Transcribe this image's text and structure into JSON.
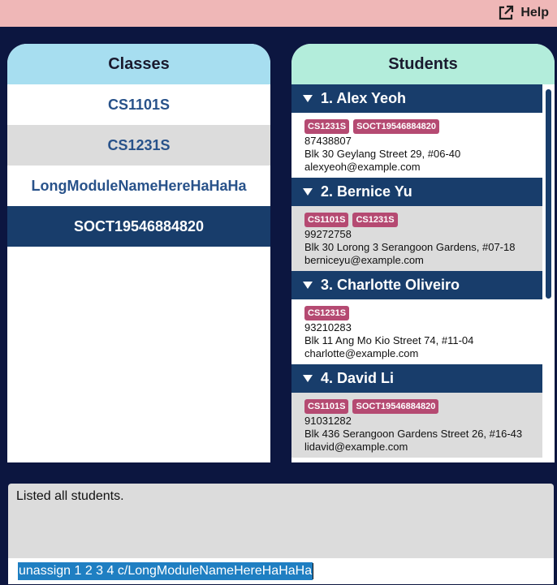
{
  "topbar": {
    "help_label": "Help"
  },
  "classes": {
    "header": "Classes",
    "items": [
      "CS1101S",
      "CS1231S",
      "LongModuleNameHereHaHaHa",
      "SOCT19546884820"
    ],
    "selected_index": 3
  },
  "students": {
    "header": "Students",
    "cards": [
      {
        "title": "1. Alex Yeoh",
        "tags": [
          "CS1231S",
          "SOCT19546884820"
        ],
        "phone": "87438807",
        "address": "Blk 30 Geylang Street 29, #06-40",
        "email": "alexyeoh@example.com"
      },
      {
        "title": "2. Bernice Yu",
        "tags": [
          "CS1101S",
          "CS1231S"
        ],
        "phone": "99272758",
        "address": "Blk 30 Lorong 3 Serangoon Gardens, #07-18",
        "email": "berniceyu@example.com"
      },
      {
        "title": "3. Charlotte Oliveiro",
        "tags": [
          "CS1231S"
        ],
        "phone": "93210283",
        "address": "Blk 11 Ang Mo Kio Street 74, #11-04",
        "email": "charlotte@example.com"
      },
      {
        "title": "4. David Li",
        "tags": [
          "CS1101S",
          "SOCT19546884820"
        ],
        "phone": "91031282",
        "address": "Blk 436 Serangoon Gardens Street 26, #16-43",
        "email": "lidavid@example.com"
      }
    ]
  },
  "result": {
    "text": "Listed all students."
  },
  "command": {
    "value": "unassign 1 2 3 4 c/LongModuleNameHereHaHaHa"
  },
  "colors": {
    "topbar": "#efb7b7",
    "background": "#0c1640",
    "classes_header": "#a7def0",
    "students_header": "#b3eddb",
    "card_title": "#183d6b",
    "tag": "#b54a72",
    "selected_class": "#183d6b",
    "command_highlight": "#1f7fc2"
  },
  "icons": {
    "help": "external-link-icon",
    "card_toggle": "triangle-down-icon"
  }
}
